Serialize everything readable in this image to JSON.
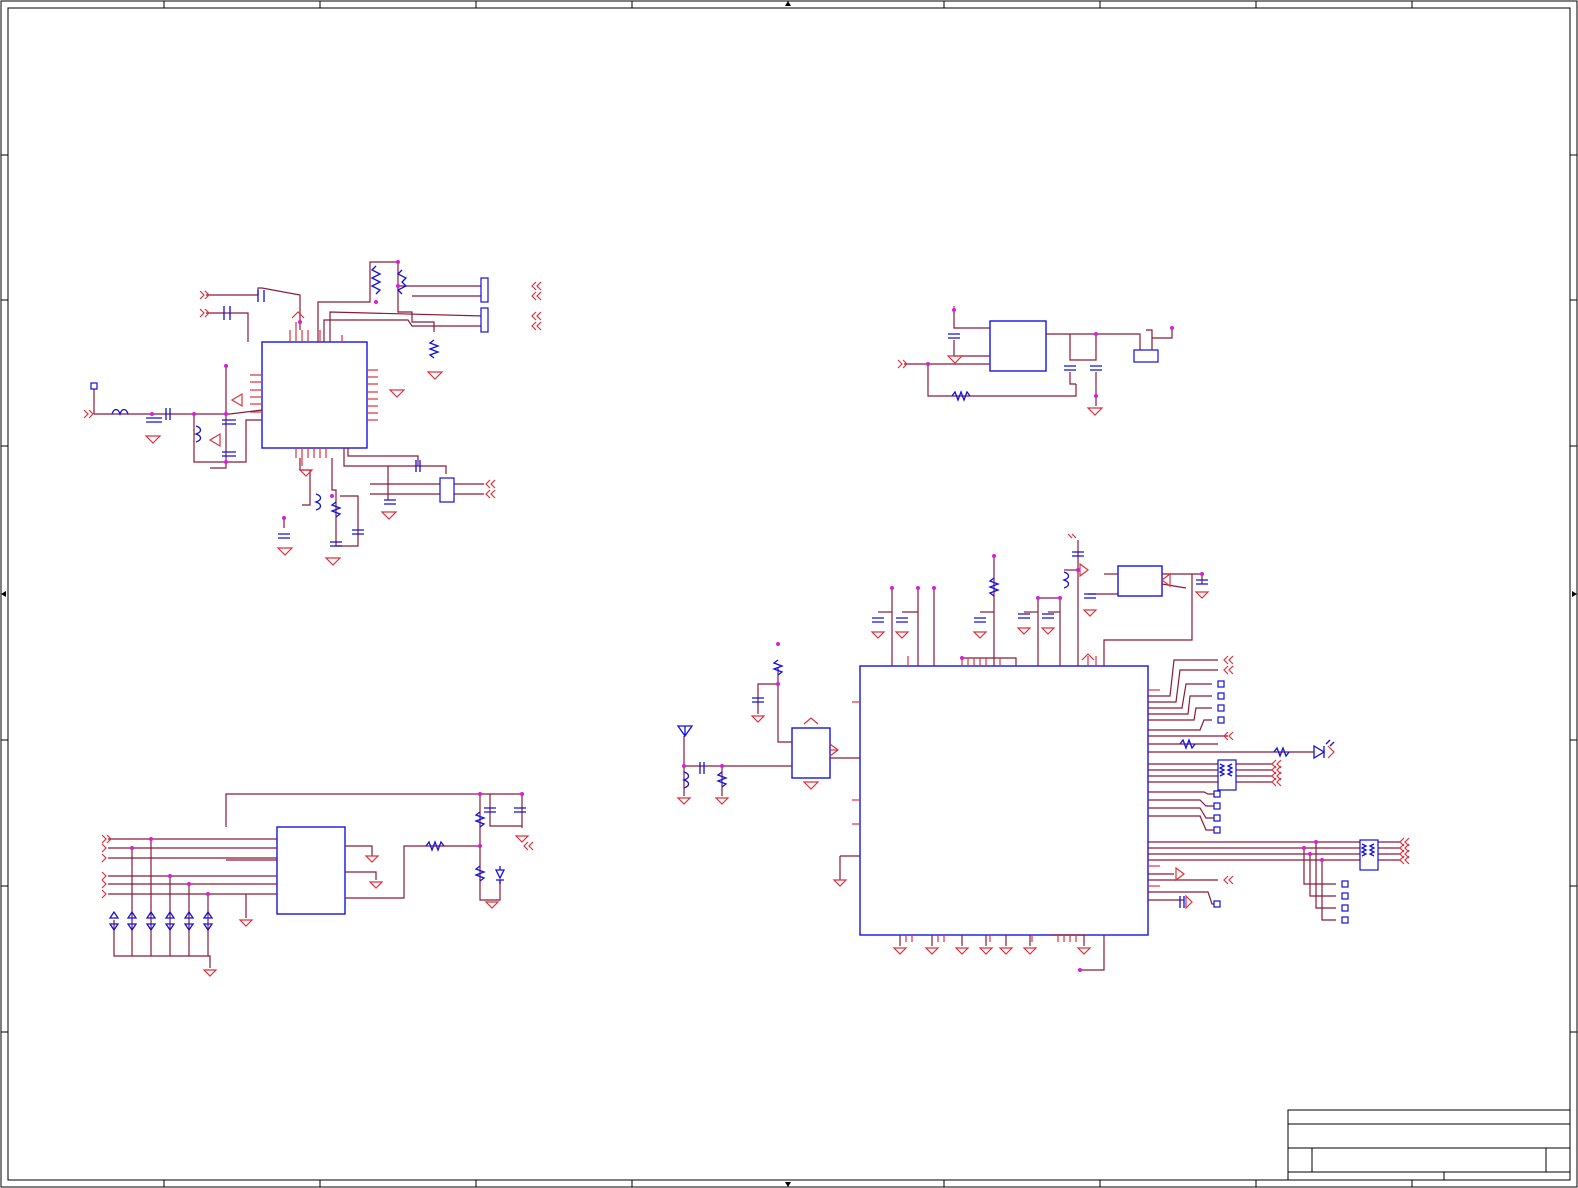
{
  "schematic": {
    "border_tick_columns": 10,
    "border_tick_rows": 8,
    "title_block_fields": [
      "",
      "",
      "",
      "",
      ""
    ]
  }
}
